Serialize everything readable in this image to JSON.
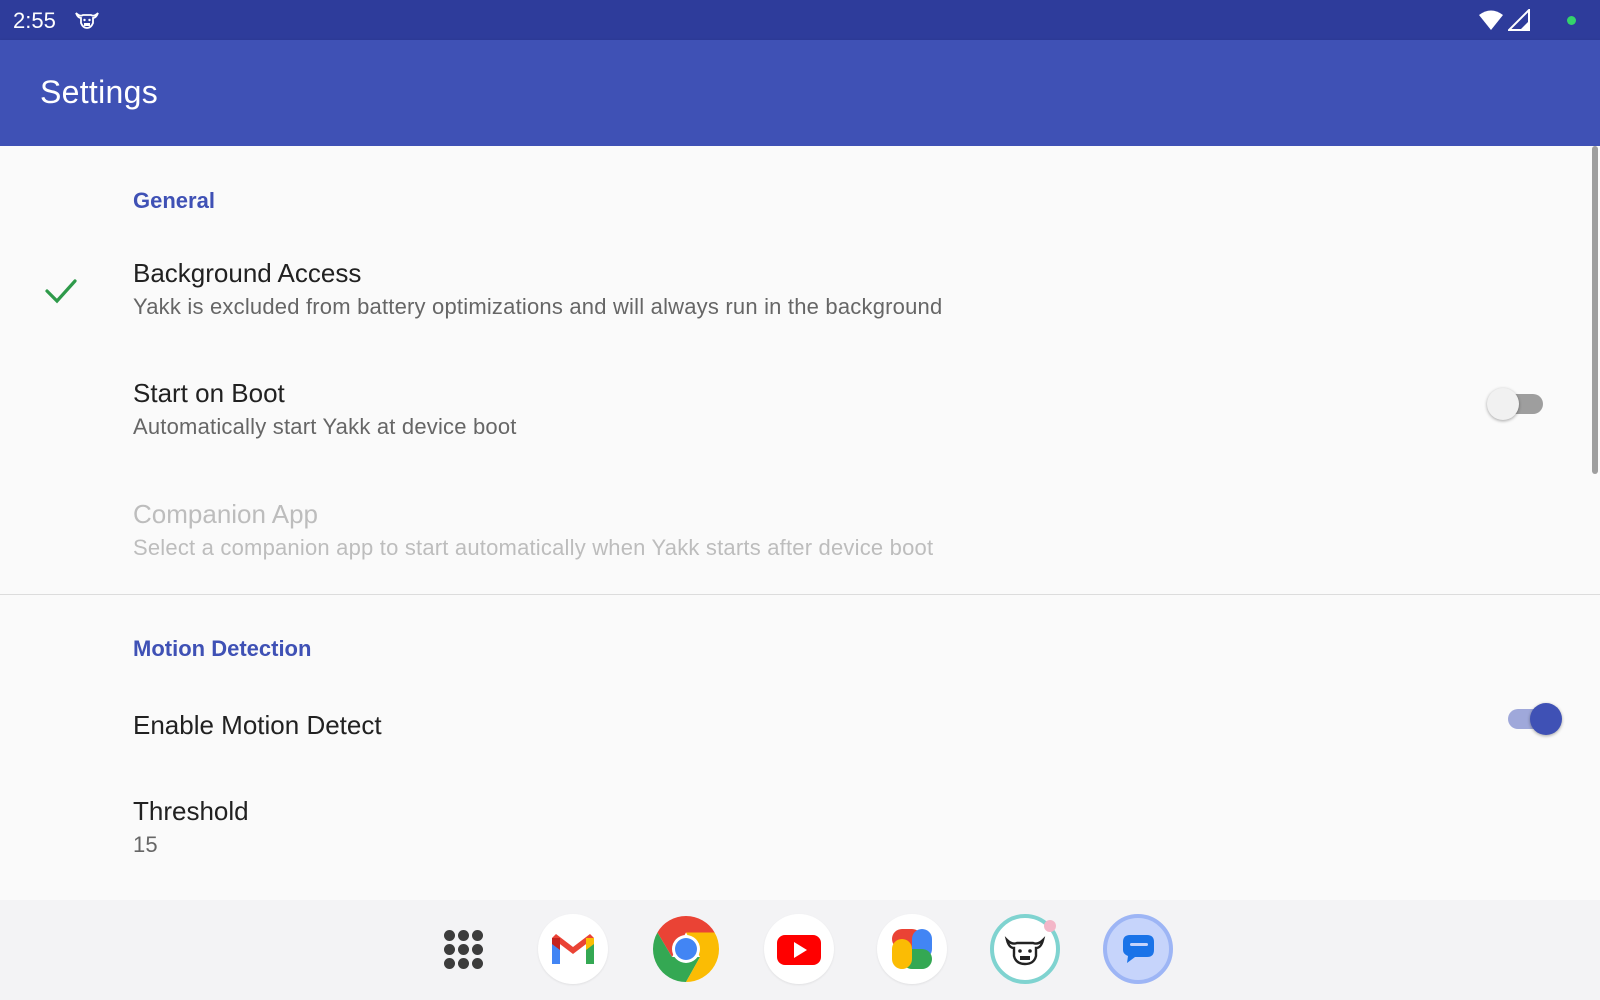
{
  "status_bar": {
    "time": "2:55",
    "icons": [
      "yakk-notification-icon",
      "wifi-icon",
      "signal-icon",
      "green-dot-icon"
    ]
  },
  "app_bar": {
    "title": "Settings"
  },
  "general": {
    "header": "General",
    "background_access": {
      "title": "Background Access",
      "summary": "Yakk is excluded from battery optimizations and will always run in the background",
      "status_icon": "check-icon"
    },
    "start_on_boot": {
      "title": "Start on Boot",
      "summary": "Automatically start Yakk at device boot",
      "enabled": false
    },
    "companion_app": {
      "title": "Companion App",
      "summary": "Select a companion app to start automatically when Yakk starts after device boot",
      "disabled": true
    }
  },
  "motion_detection": {
    "header": "Motion Detection",
    "enable_motion_detect": {
      "title": "Enable Motion Detect",
      "enabled": true
    },
    "threshold": {
      "title": "Threshold",
      "value": "15"
    }
  },
  "dock": {
    "apps": [
      "apps-grid-icon",
      "gmail-icon",
      "chrome-icon",
      "youtube-icon",
      "photos-icon",
      "yakk-icon",
      "messages-icon"
    ]
  },
  "colors": {
    "status_bar": "#2e3c9b",
    "app_bar": "#3f51b5",
    "accent": "#3f51b5",
    "check": "#2e9a4a"
  }
}
